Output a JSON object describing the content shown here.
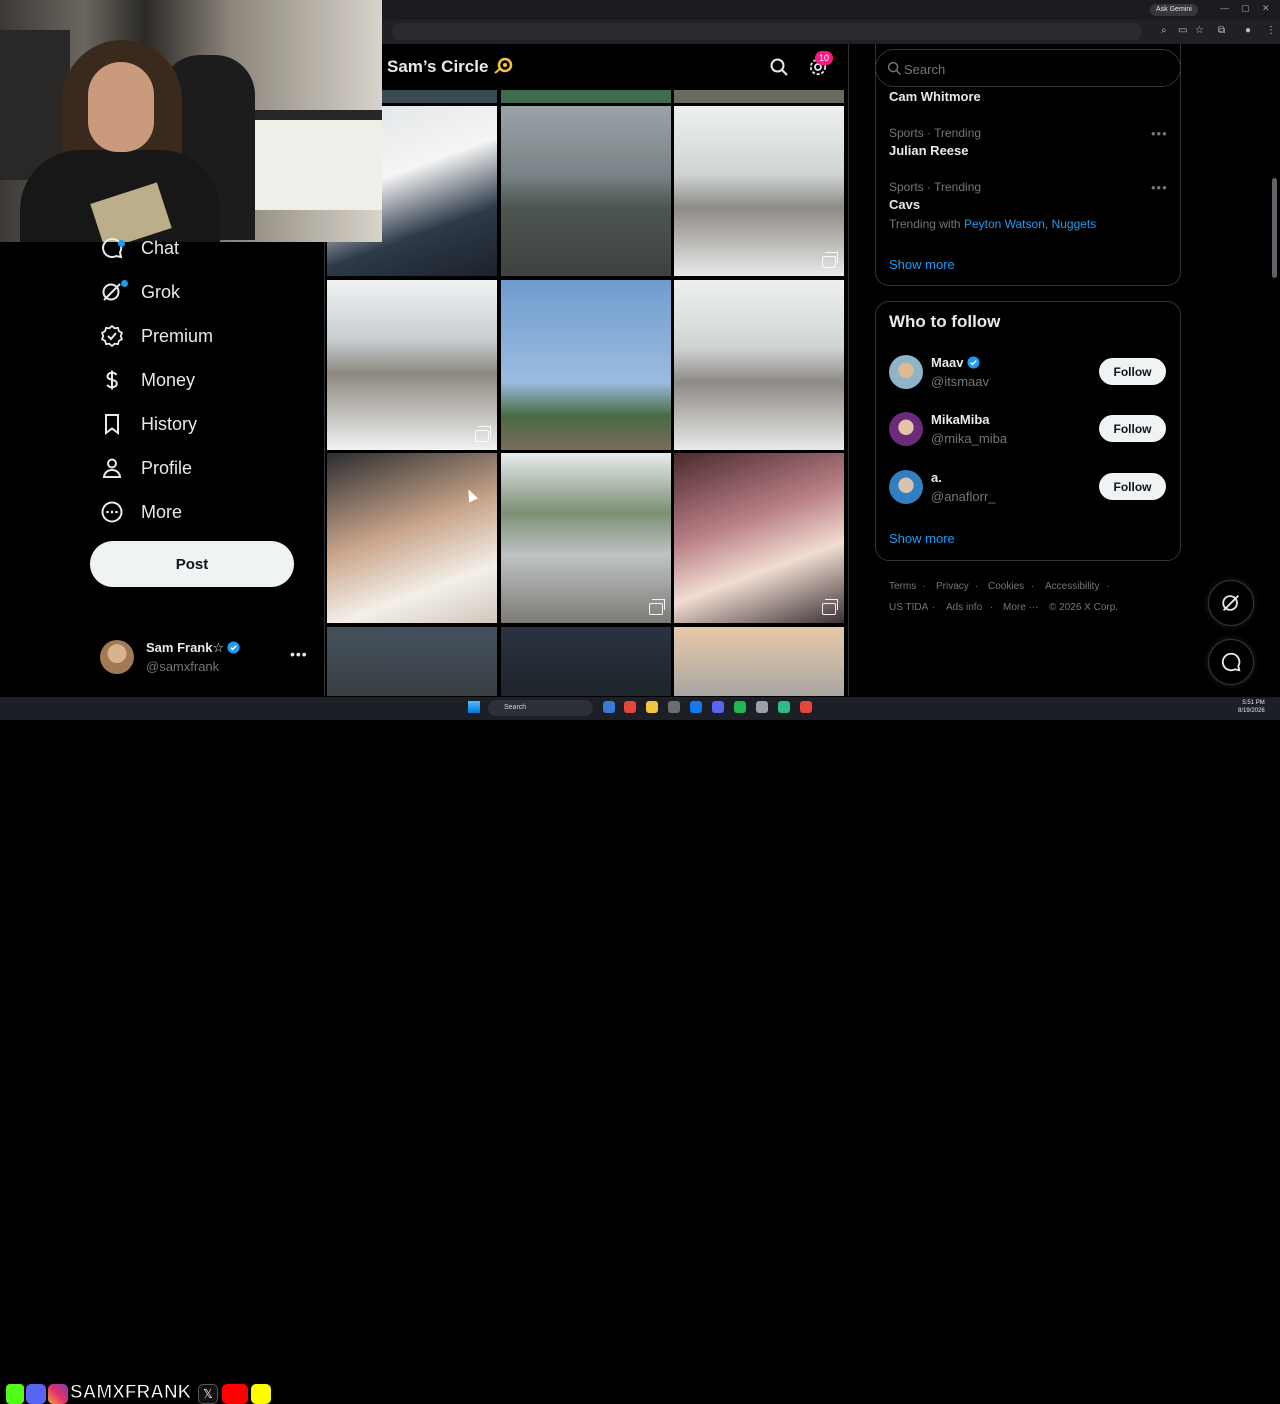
{
  "browser": {
    "ask_gemini": "Ask Gemini",
    "window_controls": [
      "—",
      "▢",
      "✕"
    ]
  },
  "nav": {
    "items": [
      {
        "label": "Chat",
        "icon": "chat-icon"
      },
      {
        "label": "Grok",
        "icon": "grok-icon"
      },
      {
        "label": "Premium",
        "icon": "premium-icon"
      },
      {
        "label": "Money",
        "icon": "money-icon"
      },
      {
        "label": "History",
        "icon": "bookmark-icon"
      },
      {
        "label": "Profile",
        "icon": "person-icon"
      },
      {
        "label": "More",
        "icon": "more-circle-icon"
      }
    ],
    "post_label": "Post",
    "account": {
      "name": "Sam Frank☆",
      "handle": "@samxfrank"
    }
  },
  "circle": {
    "title": "Sam’s Circle",
    "notification_count": "10"
  },
  "search": {
    "placeholder": "Search"
  },
  "trends": {
    "top_name": "Cam Whitmore",
    "items": [
      {
        "meta": "Sports · Trending",
        "name": "Julian Reese"
      },
      {
        "meta": "Sports · Trending",
        "name": "Cavs",
        "with_prefix": "Trending with",
        "with_links": [
          "Peyton Watson",
          "Nuggets"
        ]
      }
    ],
    "show_more": "Show more"
  },
  "who_to_follow": {
    "title": "Who to follow",
    "accounts": [
      {
        "name": "Maav",
        "handle": "@itsmaav",
        "verified": true,
        "button": "Follow"
      },
      {
        "name": "MikaMiba",
        "handle": "@mika_miba",
        "verified": false,
        "button": "Follow"
      },
      {
        "name": "a.",
        "handle": "@anaflorr_",
        "verified": false,
        "button": "Follow"
      }
    ],
    "show_more": "Show more"
  },
  "footer": {
    "row1": [
      "Terms",
      "Privacy",
      "Cookies",
      "Accessibility"
    ],
    "row2": [
      "US TIDA",
      "Ads info",
      "More ···",
      "© 2026 X Corp."
    ]
  },
  "overlay": {
    "tag": "SAMXFRANK"
  },
  "taskbar": {
    "search": "Search",
    "time": "5:51 PM",
    "date": "8/19/2026"
  },
  "colors": {
    "accent": "#1d9bf0",
    "badge": "#f91880",
    "background": "#000000",
    "text": "#e7e9ea",
    "muted": "#71767b",
    "border": "#2f3336"
  }
}
